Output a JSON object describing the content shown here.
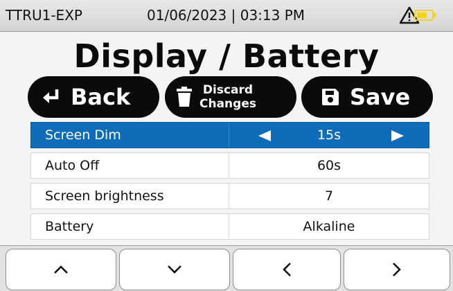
{
  "status_bar": {
    "device_name": "TTRU1-EXP",
    "datetime": "01/06/2023 | 03:13 PM",
    "icons": [
      "warning-icon",
      "battery-icon"
    ],
    "battery_color": "#f7d21a"
  },
  "page_title": "Display / Battery",
  "actions": {
    "back_label": "Back",
    "discard_label_line1": "Discard",
    "discard_label_line2": "Changes",
    "save_label": "Save"
  },
  "settings": [
    {
      "label": "Screen Dim",
      "value": "15s",
      "selected": true
    },
    {
      "label": "Auto Off",
      "value": "60s",
      "selected": false
    },
    {
      "label": "Screen brightness",
      "value": "7",
      "selected": false
    },
    {
      "label": "Battery",
      "value": "Alkaline",
      "selected": false
    }
  ],
  "nav": {
    "icons": [
      "chevron-up-icon",
      "chevron-down-icon",
      "chevron-left-icon",
      "chevron-right-icon"
    ]
  },
  "colors": {
    "selection": "#0f6cb8",
    "button_bg": "#0b0b0b"
  }
}
